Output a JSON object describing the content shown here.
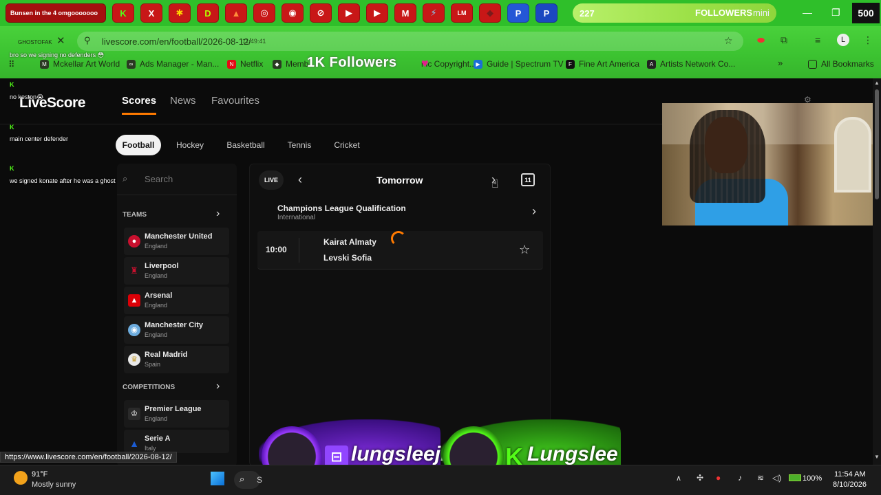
{
  "browser": {
    "tabs_first_text": "Bunsen in the 4 omgooooooo",
    "tab_icons": [
      "K",
      "X",
      "✱",
      "D",
      "▲",
      "◎",
      "◉",
      "⊘",
      "▶",
      "▶",
      "M",
      "⚡",
      "LM",
      "◆",
      "P",
      "P"
    ],
    "goal": {
      "count": "227",
      "label": "FOLLOWERS",
      "extra": "mini",
      "total": "500"
    },
    "window_controls": [
      "—",
      "❐",
      "✕"
    ],
    "tiny_overlay": "GHOSTOFAK",
    "url": "livescore.com/en/football/2026-08-12/",
    "url_overlay": "11:49:41",
    "bookmarks": [
      {
        "label": "Mckellar Art World",
        "icon": "M"
      },
      {
        "label": "Ads Manager - Man...",
        "icon": "∞"
      },
      {
        "label": "Netflix",
        "icon": "N"
      },
      {
        "label": "Memb...",
        "icon": "◆"
      },
      {
        "label": "nic Copyright...",
        "icon": ""
      },
      {
        "label": "Guide | Spectrum TV",
        "icon": "▶"
      },
      {
        "label": "Fine Art America",
        "icon": "F"
      },
      {
        "label": "Artists Network Co...",
        "icon": "A"
      }
    ],
    "all_bookmarks": "All Bookmarks",
    "k_followers": "1K Followers"
  },
  "chat": [
    {
      "text": "bro so we signing no defenders 😳"
    },
    {
      "text": "no keston😭"
    },
    {
      "text": "main center defender"
    },
    {
      "text": "we signed konate after he was a ghost last season"
    }
  ],
  "livescore": {
    "logo": "LiveScore",
    "nav": [
      "Scores",
      "News",
      "Favourites"
    ],
    "sports": [
      "Football",
      "Hockey",
      "Basketball",
      "Tennis",
      "Cricket"
    ],
    "search_placeholder": "Search",
    "teams_title": "TEAMS",
    "teams": [
      {
        "name": "Manchester United",
        "country": "England",
        "color": "#c8102e"
      },
      {
        "name": "Liverpool",
        "country": "England",
        "color": "#c8102e"
      },
      {
        "name": "Arsenal",
        "country": "England",
        "color": "#db0007"
      },
      {
        "name": "Manchester City",
        "country": "England",
        "color": "#6cabdd"
      },
      {
        "name": "Real Madrid",
        "country": "Spain",
        "color": "#e9e9e9"
      }
    ],
    "competitions_title": "COMPETITIONS",
    "competitions": [
      {
        "name": "Premier League",
        "country": "England",
        "color": "#3d195b"
      },
      {
        "name": "Serie A",
        "country": "Italy",
        "color": "#1b5cd4"
      }
    ],
    "live_label": "LIVE",
    "date_label": "Tomorrow",
    "calendar_day": "11",
    "competition": {
      "name": "Champions League Qualification",
      "region": "International"
    },
    "match": {
      "time": "10:00",
      "home": "Kairat Almaty",
      "away": "Levski Sofia"
    }
  },
  "status_url": "https://www.livescore.com/en/football/2026-08-12/",
  "banner": {
    "twitch": "lungsleejr",
    "kick": "Lungslee"
  },
  "taskbar": {
    "weather_temp": "91°F",
    "weather_desc": "Mostly sunny",
    "search_stub": "S",
    "battery": "100%",
    "time": "11:54 AM",
    "date": "8/10/2026"
  }
}
